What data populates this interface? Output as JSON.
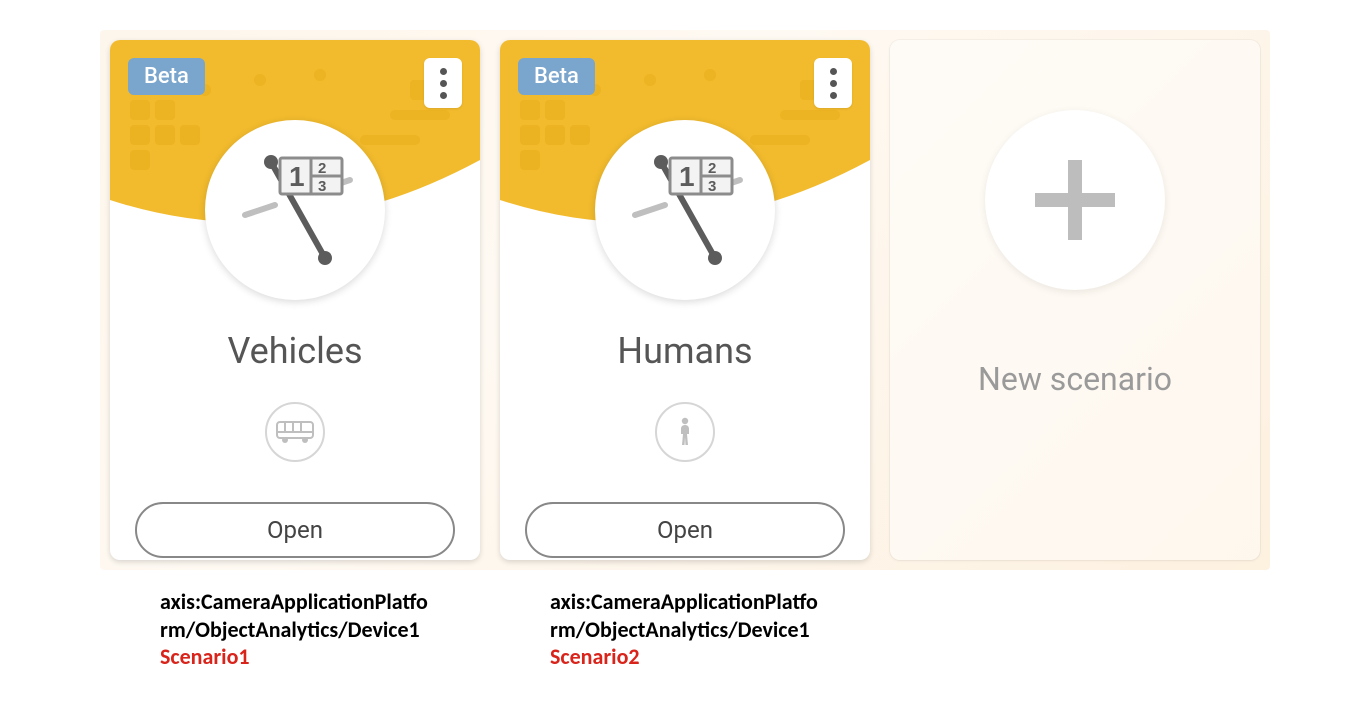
{
  "cards": [
    {
      "badge": "Beta",
      "title": "Vehicles",
      "icon": "bus",
      "open_label": "Open",
      "caption_prefix": "axis:CameraApplicationPlatform/ObjectAnalytics/Device1",
      "caption_red": "Scenario1"
    },
    {
      "badge": "Beta",
      "title": "Humans",
      "icon": "person",
      "open_label": "Open",
      "caption_prefix": "axis:CameraApplicationPlatform/ObjectAnalytics/Device1",
      "caption_red": "Scenario2"
    }
  ],
  "new_card": {
    "label": "New scenario"
  }
}
